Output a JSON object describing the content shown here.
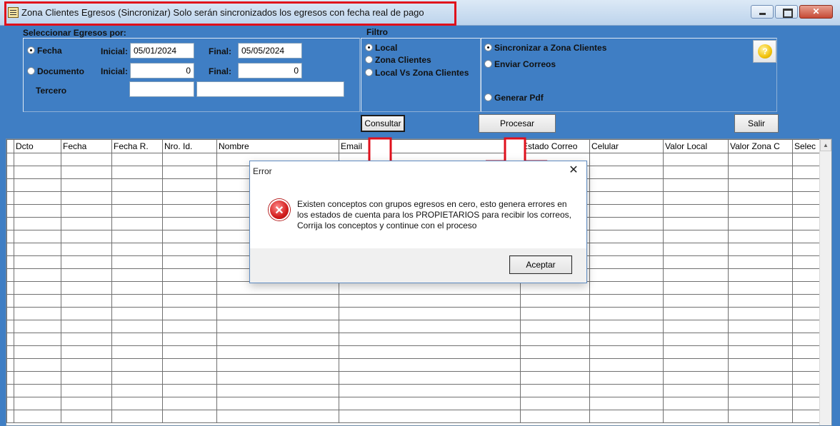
{
  "window": {
    "title": "Zona Clientes Egresos (Sincronizar) Solo serán sincronizados los egresos con fecha real de pago"
  },
  "form": {
    "seleccionar_label": "Seleccionar Egresos por:",
    "fecha_option": "Fecha",
    "documento_option": "Documento",
    "inicial_label": "Inicial:",
    "final_label": "Final:",
    "tercero_label": "Tercero",
    "fecha_inicial": "05/01/2024",
    "fecha_final": "05/05/2024",
    "doc_inicial": "0",
    "doc_final": "0",
    "tercero_code": "",
    "tercero_name": "",
    "selected_criterion": "Fecha"
  },
  "filtro": {
    "label": "Filtro",
    "options": [
      "Local",
      "Zona Clientes",
      "Local Vs Zona Clientes"
    ],
    "selected": "Local"
  },
  "acciones": {
    "options": [
      "Sincronizar a Zona Clientes",
      "Enviar Correos",
      "Generar Pdf"
    ],
    "selected": "Sincronizar a Zona Clientes"
  },
  "buttons": {
    "consultar": "Consultar",
    "procesar": "Procesar",
    "salir": "Salir",
    "help_icon": "?"
  },
  "grid": {
    "columns": [
      "Dcto",
      "Fecha",
      "Fecha R.",
      "Nro. Id.",
      "Nombre",
      "Email",
      "Estado Correo",
      "Celular",
      "Valor Local",
      "Valor Zona C",
      "Selec"
    ]
  },
  "dialog": {
    "title": "Error",
    "close_glyph": "✕",
    "message_lines": [
      "Existen conceptos con grupos egresos en cero, esto genera errores en",
      "los estados de cuenta para los PROPIETARIOS para recibir los correos,",
      "Corrija los conceptos y continue con el proceso"
    ],
    "ok_label": "Aceptar"
  },
  "annotations": {
    "highlight_color": "#e0101c"
  }
}
